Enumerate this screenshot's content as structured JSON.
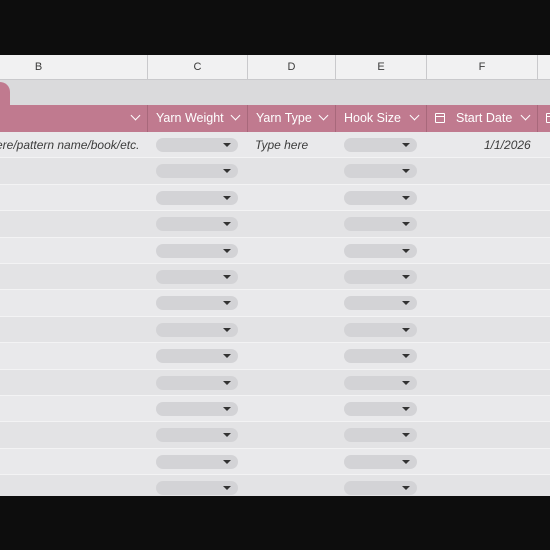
{
  "columns": {
    "letters": [
      "B",
      "C",
      "D",
      "E",
      "F"
    ]
  },
  "table": {
    "headers": {
      "yarn_weight": "Yarn Weight",
      "yarn_type": "Yarn Type",
      "hook_size": "Hook Size",
      "start_date": "Start Date"
    },
    "first_row": {
      "pattern": "ere/pattern name/book/etc.",
      "yarn_type": "Type here",
      "start_date": "1/1/2026"
    }
  },
  "colors": {
    "header_accent": "#c07a8f"
  },
  "icons": {
    "header_dropdown": "chevron-down-icon",
    "cell_dropdown": "caret-down-icon",
    "date_column": "calendar-icon"
  }
}
